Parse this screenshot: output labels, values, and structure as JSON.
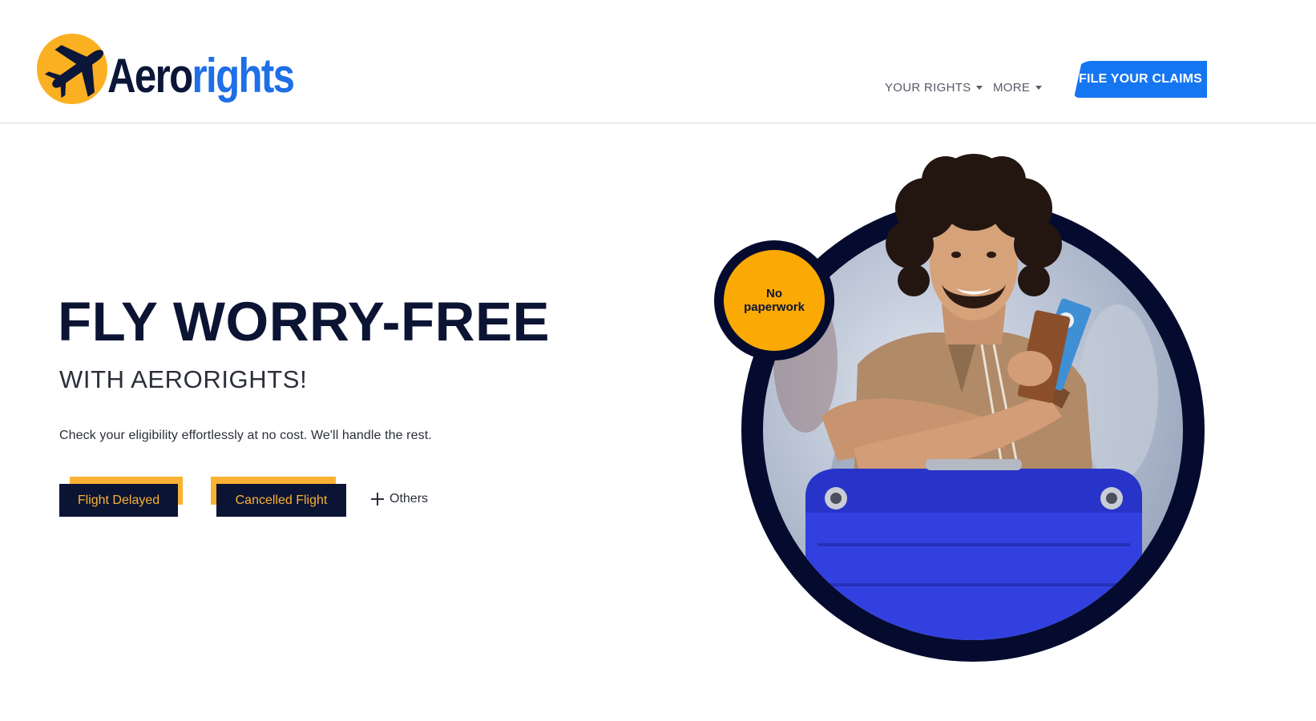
{
  "header": {
    "logo": {
      "part1": "Aero",
      "part2": "rights",
      "icon": "airplane-icon"
    },
    "nav": {
      "your_rights": "YOUR RIGHTS",
      "more": "MORE"
    },
    "cta_label": "FILE YOUR CLAIMS"
  },
  "hero": {
    "title": "FLY WORRY-FREE",
    "subtitle": "WITH AERORIGHTS!",
    "description": "Check your eligibility effortlessly at no cost. We'll handle the rest.",
    "buttons": {
      "flight_delayed": "Flight Delayed",
      "cancelled_flight": "Cancelled Flight",
      "others": "Others"
    },
    "badge": {
      "line1": "No",
      "line2": "paperwork"
    }
  },
  "colors": {
    "navy": "#0c1434",
    "yellow": "#f9b233",
    "blue": "#1576f2",
    "badge": "#fba904"
  }
}
